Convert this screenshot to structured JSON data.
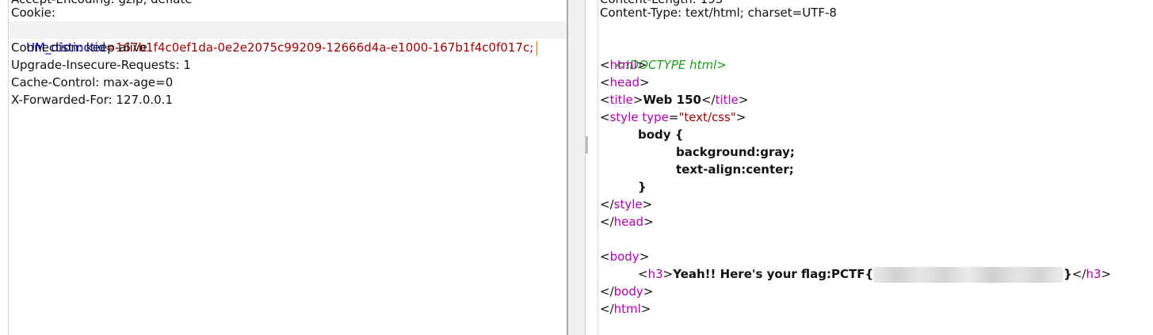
{
  "request": {
    "cut_top_fragment": "Accept-Encoding: gzip, deflate",
    "cookie_label": "Cookie:",
    "cookie_name": "UM_distinctid",
    "cookie_eq": "=",
    "cookie_value": "167b1f4c0ef1da-0e2e2075c99209-12666d4a-e1000-167b1f4c0f017c;",
    "lines": [
      "Connection: keep-alive",
      "Upgrade-Insecure-Requests: 1",
      "Cache-Control: max-age=0",
      "X-Forwarded-For: 127.0.0.1"
    ]
  },
  "response": {
    "cut_top_fragment": "Content-Length: 193",
    "content_type": "Content-Type: text/html; charset=UTF-8",
    "doctype": "<!DOCTYPE html>",
    "tags": {
      "html": "html",
      "head": "head",
      "title": "title",
      "style": "style",
      "body": "body",
      "h3": "h3"
    },
    "title_text": "Web 150",
    "style_attr_name": "type",
    "style_attr_value": "\"text/css\"",
    "css_lines": [
      "body {",
      "background:gray;",
      "text-align:center;",
      "}"
    ],
    "h3_text": "Yeah!! Here's your flag:PCTF{",
    "h3_tail": "}"
  },
  "colors": {
    "tag": "#b000b0",
    "header_name": "#0000c0",
    "header_value": "#a00000",
    "doctype": "#1b9c1b"
  }
}
